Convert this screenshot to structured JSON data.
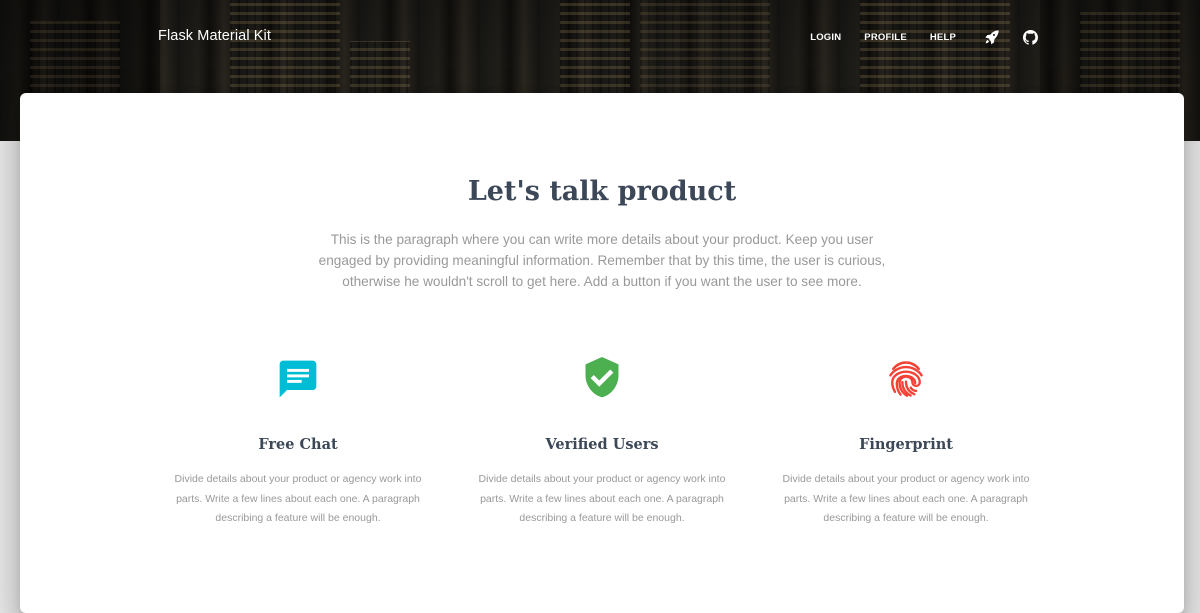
{
  "navbar": {
    "brand": "Flask Material Kit",
    "links": [
      "LOGIN",
      "PROFILE",
      "HELP"
    ],
    "icons": [
      "rocket-icon",
      "github-icon"
    ]
  },
  "main": {
    "title": "Let's talk product",
    "description": "This is the paragraph where you can write more details about your product. Keep you user engaged by providing meaningful information. Remember that by this time, the user is curious, otherwise he wouldn't scroll to get here. Add a button if you want the user to see more."
  },
  "features": [
    {
      "title": "Free Chat",
      "text": "Divide details about your product or agency work into parts. Write a few lines about each one. A paragraph describing a feature will be enough.",
      "icon": "chat-icon",
      "color": "#00bcd4"
    },
    {
      "title": "Verified Users",
      "text": "Divide details about your product or agency work into parts. Write a few lines about each one. A paragraph describing a feature will be enough.",
      "icon": "verified-shield-icon",
      "color": "#4caf50"
    },
    {
      "title": "Fingerprint",
      "text": "Divide details about your product or agency work into parts. Write a few lines about each one. A paragraph describing a feature will be enough.",
      "icon": "fingerprint-icon",
      "color": "#f44336"
    }
  ]
}
